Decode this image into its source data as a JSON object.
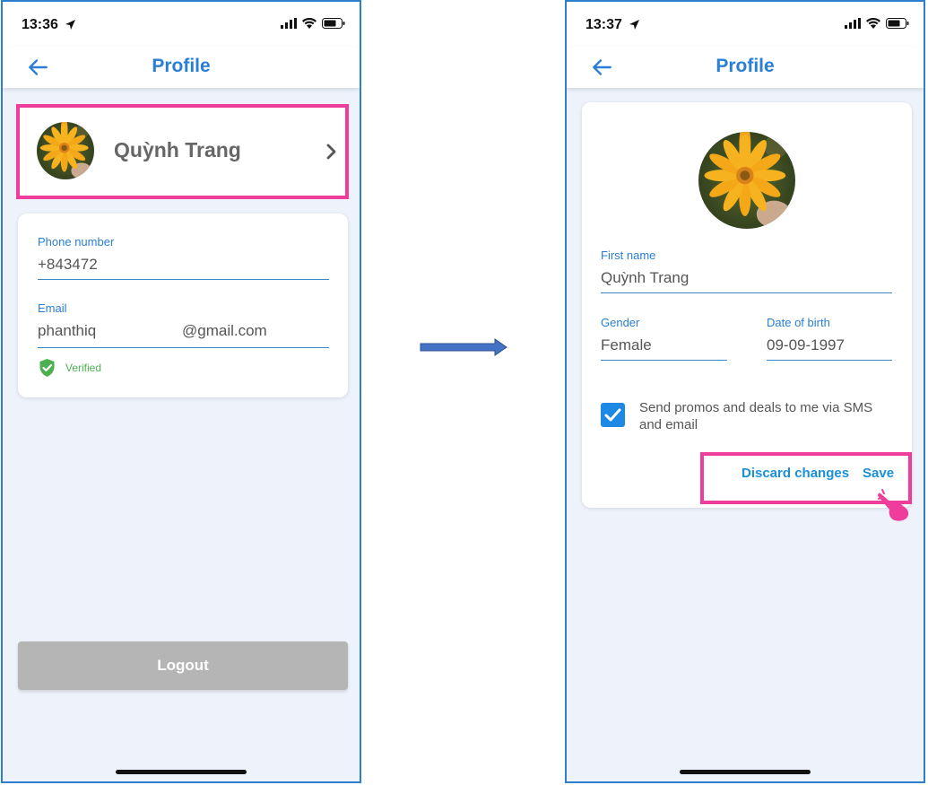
{
  "left_screen": {
    "status": {
      "time": "13:36"
    },
    "header": {
      "title": "Profile"
    },
    "profile_summary": {
      "name": "Quỳnh Trang"
    },
    "contact": {
      "phone_label": "Phone number",
      "phone_value": "+843472",
      "email_label": "Email",
      "email_local": "phanthiq",
      "email_domain": "@gmail.com",
      "verified_label": "Verified"
    },
    "logout_label": "Logout"
  },
  "right_screen": {
    "status": {
      "time": "13:37"
    },
    "header": {
      "title": "Profile"
    },
    "form": {
      "first_name_label": "First name",
      "first_name_value": "Quỳnh Trang",
      "gender_label": "Gender",
      "gender_value": "Female",
      "dob_label": "Date of birth",
      "dob_value": "09-09-1997",
      "promo_line1": "Send promos and deals to me via SMS",
      "promo_line2": "and email",
      "promo_checked": true
    },
    "actions": {
      "discard_label": "Discard changes",
      "save_label": "Save"
    }
  },
  "colors": {
    "accent": "#2a7fd4",
    "highlight": "#ee3d9a",
    "verified": "#4caf50",
    "checkbox": "#1e88e5",
    "logout_bg": "#b5b5b5",
    "flow_arrow": "#3f6fbf"
  },
  "icons": [
    "back-arrow-icon",
    "location-arrow-icon",
    "signal-icon",
    "wifi-icon",
    "battery-icon",
    "chevron-right-icon",
    "shield-check-icon",
    "checkmark-icon",
    "pointing-hand-icon",
    "flow-arrow-icon"
  ]
}
